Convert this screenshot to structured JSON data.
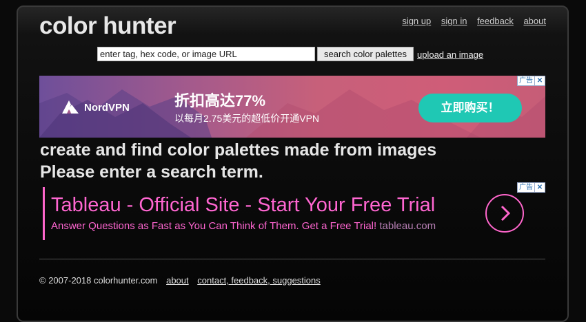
{
  "header": {
    "logo": "color hunter",
    "links": [
      "sign up",
      "sign in",
      "feedback",
      "about"
    ]
  },
  "search": {
    "placeholder": "enter tag, hex code, or image URL",
    "button_label": "search color palettes",
    "upload_link": "upload an image"
  },
  "ad_banner": {
    "brand": "NordVPN",
    "headline": "折扣高达77%",
    "subline": "以每月2.75美元的超低价开通VPN",
    "cta": "立即购买！",
    "badge": "广告",
    "close": "✕"
  },
  "main": {
    "tagline": "create and find color palettes made from images",
    "message": "Please enter a search term."
  },
  "text_ad": {
    "title": "Tableau - Official Site - Start Your Free Trial",
    "description": "Answer Questions as Fast as You Can Think of Them. Get a Free Trial!",
    "domain": "tableau.com",
    "badge": "广告",
    "close": "✕",
    "arrow_icon": "chevron-right-icon"
  },
  "footer": {
    "copyright": "© 2007-2018 colorhunter.com",
    "links": [
      "about",
      "contact, feedback, suggestions"
    ]
  }
}
